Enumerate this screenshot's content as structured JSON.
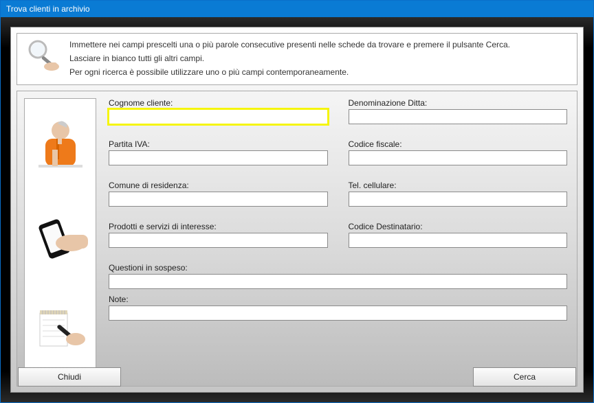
{
  "window": {
    "title": "Trova clienti in archivio"
  },
  "info": {
    "line1": "Immettere nei campi prescelti una o più parole consecutive presenti nelle schede da trovare e premere il pulsante Cerca.",
    "line2": "Lasciare in bianco tutti gli altri campi.",
    "line3": "Per ogni ricerca è possibile utilizzare uno o più campi contemporaneamente."
  },
  "fields": {
    "cognome": {
      "label": "Cognome cliente:",
      "value": ""
    },
    "denominazione": {
      "label": "Denominazione Ditta:",
      "value": ""
    },
    "partita_iva": {
      "label": "Partita IVA:",
      "value": ""
    },
    "codice_fiscale": {
      "label": "Codice fiscale:",
      "value": ""
    },
    "comune": {
      "label": "Comune di residenza:",
      "value": ""
    },
    "cellulare": {
      "label": "Tel. cellulare:",
      "value": ""
    },
    "prodotti": {
      "label": "Prodotti e servizi di interesse:",
      "value": ""
    },
    "destinatario": {
      "label": "Codice Destinatario:",
      "value": ""
    },
    "questioni": {
      "label": "Questioni in sospeso:",
      "value": ""
    },
    "note": {
      "label": "Note:",
      "value": ""
    }
  },
  "buttons": {
    "close": "Chiudi",
    "search": "Cerca"
  },
  "icons": {
    "info": "magnifier-hand-icon",
    "thumb1": "person-thinking-icon",
    "thumb2": "phone-hand-icon",
    "thumb3": "notepad-pen-icon"
  }
}
